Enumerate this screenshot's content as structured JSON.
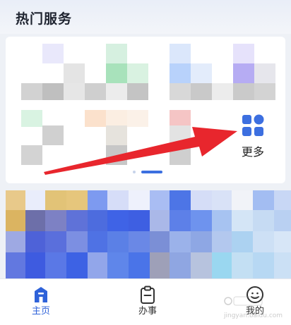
{
  "section": {
    "title": "热门服务"
  },
  "more": {
    "label": "更多",
    "icon": "grid-four-icon"
  },
  "tabbar": {
    "tabs": [
      {
        "label": "主页",
        "icon": "home-icon",
        "active": true
      },
      {
        "label": "办事",
        "icon": "clipboard-icon",
        "active": false
      },
      {
        "label": "我的",
        "icon": "user-face-icon",
        "active": false
      }
    ]
  },
  "watermark": {
    "text": "jingyan.baidu.com",
    "logo": "baidu-experience-logo"
  },
  "colors": {
    "accent": "#3c6fe0",
    "arrow": "#e8262d",
    "tab_active": "#2e62d9"
  }
}
